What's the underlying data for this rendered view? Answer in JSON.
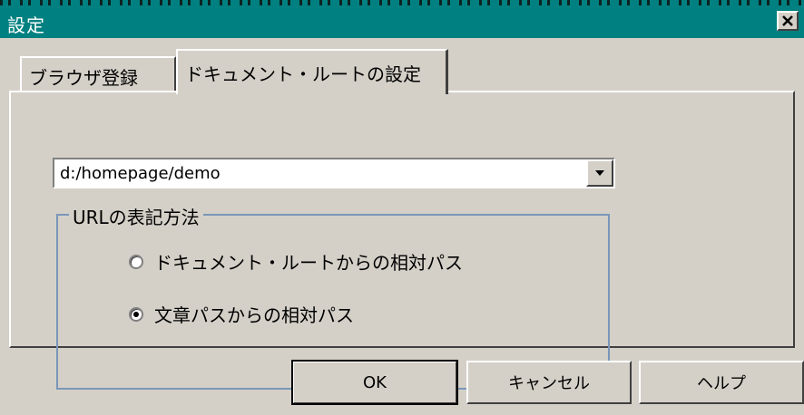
{
  "window": {
    "title": "設定",
    "close_glyph": "×"
  },
  "tabs": [
    {
      "label": "ブラウザ登録",
      "active": false
    },
    {
      "label": "ドキュメント・ルートの設定",
      "active": true
    }
  ],
  "document_root": {
    "value": "d:/homepage/demo"
  },
  "url_notation": {
    "legend": "URLの表記方法",
    "options": [
      {
        "label": "ドキュメント・ルートからの相対パス",
        "checked": false
      },
      {
        "label": "文章パスからの相対パス",
        "checked": true
      }
    ]
  },
  "buttons": {
    "ok": "OK",
    "cancel": "キャンセル",
    "help": "ヘルプ"
  },
  "colors": {
    "titlebar": "#008080",
    "face": "#d4d0c8",
    "groupbox_border": "#7a96b8"
  }
}
